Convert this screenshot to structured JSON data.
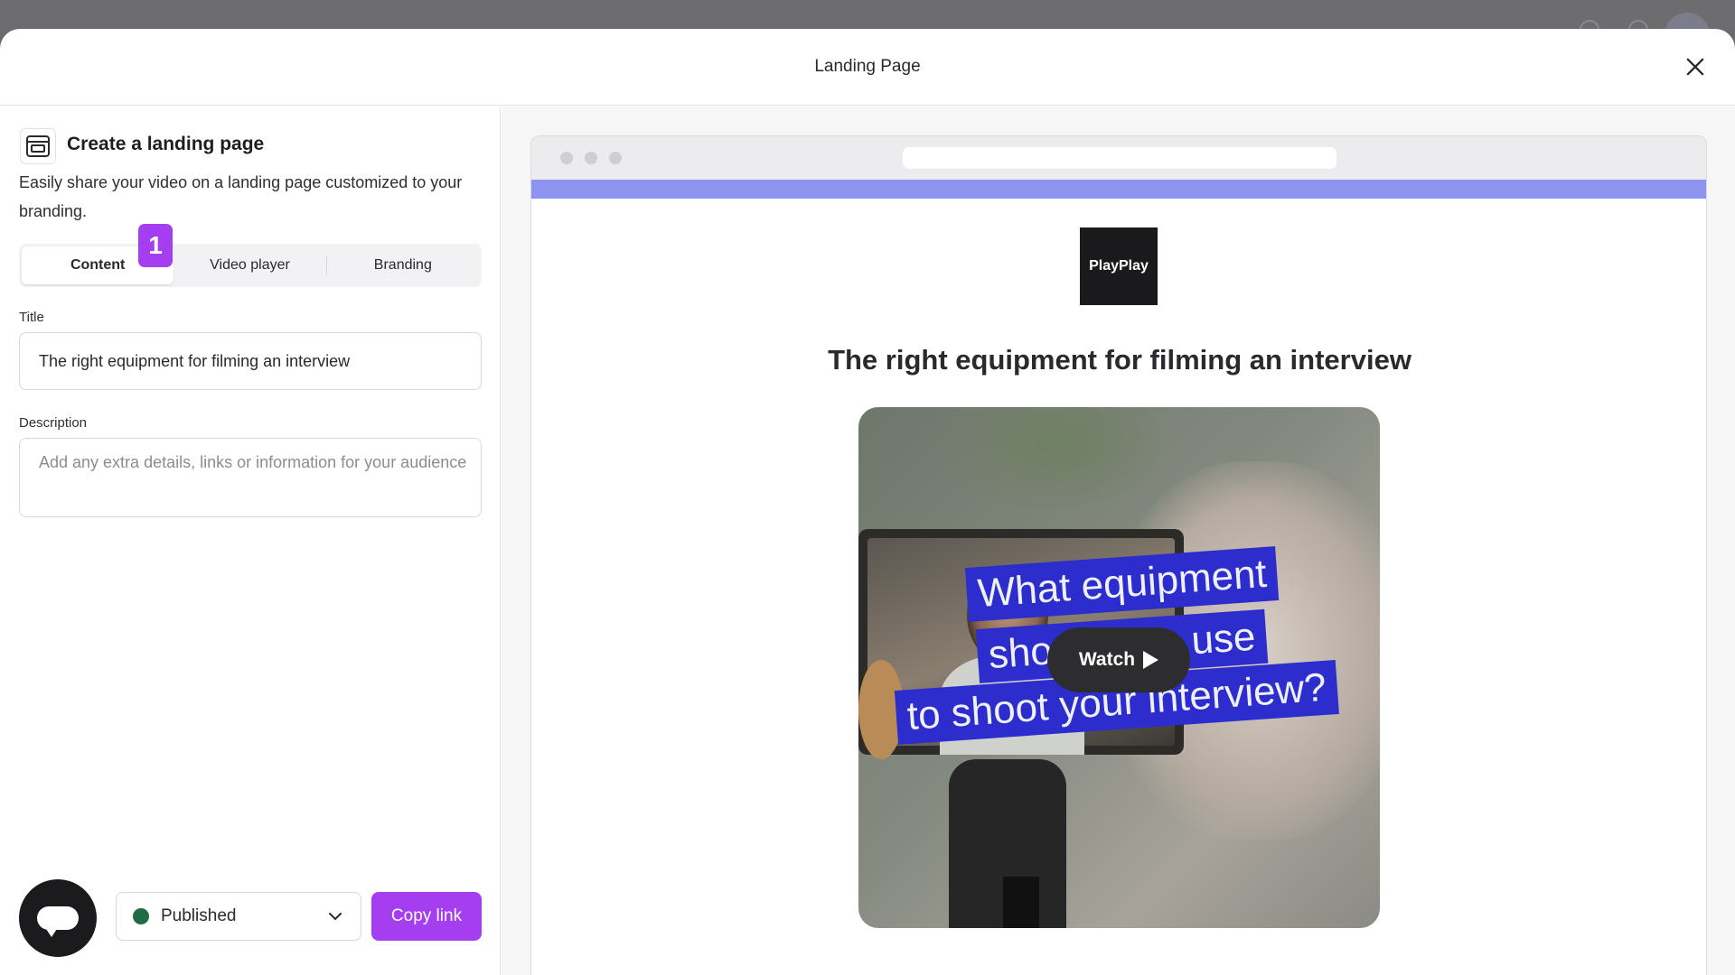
{
  "modal": {
    "title": "Landing Page"
  },
  "panel": {
    "heading": "Create a landing page",
    "description": "Easily share your video on a landing page customized to your branding.",
    "tabs": [
      {
        "label": "Content",
        "active": true
      },
      {
        "label": "Video player",
        "active": false
      },
      {
        "label": "Branding",
        "active": false
      }
    ],
    "step_badge": "1",
    "title_field": {
      "label": "Title",
      "value": "The right equipment for filming an interview"
    },
    "description_field": {
      "label": "Description",
      "placeholder": "Add any extra details, links or information for your audience"
    }
  },
  "footer": {
    "status": {
      "label": "Published",
      "color": "#1f6b46"
    },
    "copy_link_label": "Copy link"
  },
  "preview": {
    "accent_color": "#8f93f0",
    "logo_text": "PlayPlay",
    "title": "The right equipment for filming an interview",
    "video": {
      "caption_lines": [
        "What equipment",
        "should you use",
        "to shoot your interview?"
      ],
      "caption_color": "#2c2dcc",
      "watch_label": "Watch"
    }
  },
  "colors": {
    "brand_purple": "#a43ef0"
  }
}
